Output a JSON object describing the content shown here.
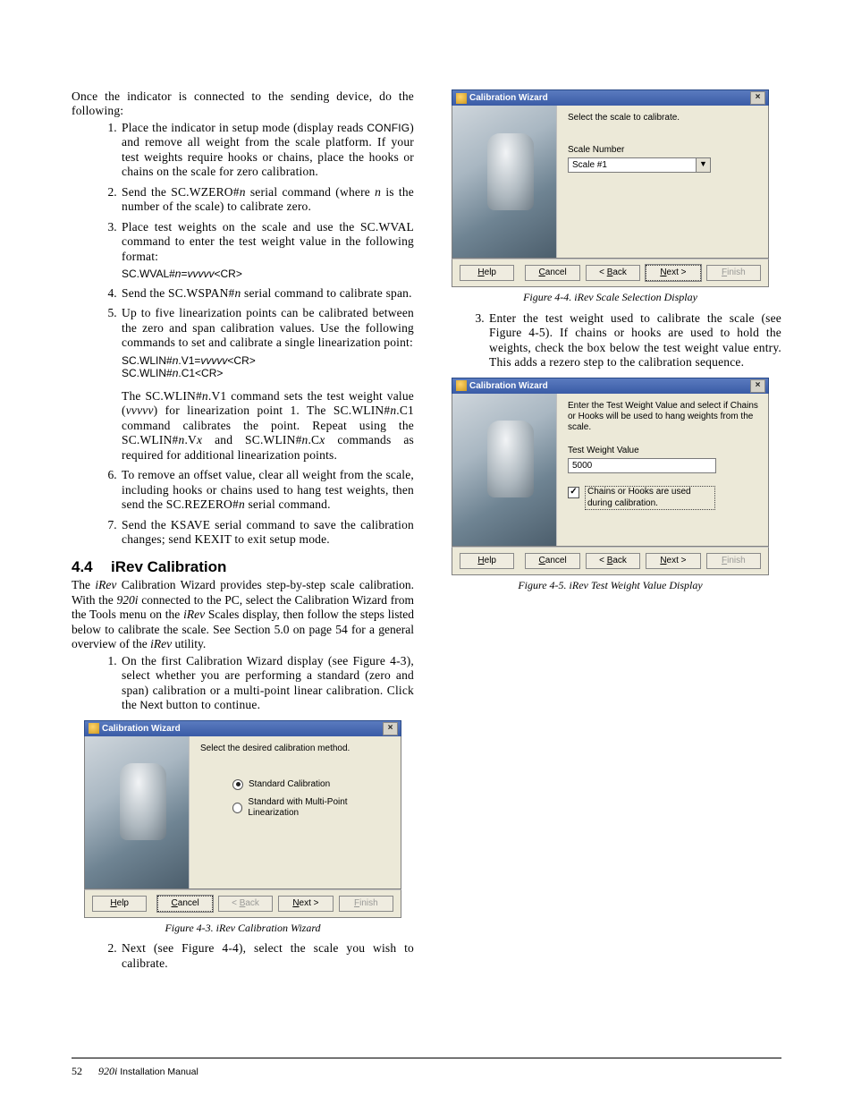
{
  "intro": "Once the indicator is connected to the sending device, do the following:",
  "steps": [
    {
      "text": "Place the indicator in setup mode (display reads CONFIG) and remove all weight from the scale platform. If your test weights require hooks or chains, place the hooks or chains on the scale for zero calibration."
    },
    {
      "text": "Send the SC.WZERO#n serial command (where n is the number of the scale) to calibrate zero."
    },
    {
      "text": "Place test weights on the scale and use the SC.WVAL command to enter the test weight value in the following format:",
      "cmd1": "SC.WVAL#n=vvvvv<CR>"
    },
    {
      "text": "Send the SC.WSPAN#n serial command to calibrate span."
    },
    {
      "text": "Up to five linearization points can be calibrated between the zero and span calibration values. Use the following commands to set and calibrate a single linearization point:",
      "cmd1": "SC.WLIN#n.V1=vvvvv<CR>",
      "cmd2": "SC.WLIN#n.C1<CR>",
      "after": "The SC.WLIN#n.V1 command sets the test weight value (vvvvv) for linearization point 1. The SC.WLIN#n.C1 command calibrates the point. Repeat using the SC.WLIN#n.Vx and SC.WLIN#n.Cx commands as required for additional linearization points."
    },
    {
      "text": "To remove an offset value, clear all weight from the scale, including hooks or chains used to hang test weights, then send the SC.REZERO#n serial command."
    },
    {
      "text": "Send the KSAVE serial command to save the calibration changes; send KEXIT to exit setup mode."
    }
  ],
  "section": {
    "num": "4.4",
    "title": "iRev Calibration"
  },
  "sectionIntro": "The iRev Calibration Wizard provides step-by-step scale calibration. With the 920i connected to the PC, select the Calibration Wizard from the Tools menu on the iRev Scales display, then follow the steps listed below to calibrate the scale. See Section 5.0 on page 54 for a general overview of the iRev utility.",
  "wizSteps": {
    "s1": "On the first Calibration Wizard display (see Figure 4-3), select whether you are performing a standard (zero and span) calibration or a multi-point linear calibration. Click the Next button to continue.",
    "s2": "Next (see Figure 4-4), select the scale you wish to calibrate.",
    "s3": "Enter the test weight used to calibrate the scale (see Figure 4-5). If chains or hooks are used to hold the weights, check the box below the test weight value entry. This adds a rezero step to the calibration sequence."
  },
  "dlg": {
    "title": "Calibration Wizard",
    "help": "Help",
    "cancel": "Cancel",
    "back": "< Back",
    "next": "Next >",
    "finish": "Finish"
  },
  "fig3": {
    "prompt": "Select the desired calibration method.",
    "opt1": "Standard Calibration",
    "opt2": "Standard with Multi-Point Linearization",
    "caption": "Figure 4-3. iRev Calibration Wizard"
  },
  "fig4": {
    "prompt": "Select the scale to calibrate.",
    "label": "Scale Number",
    "value": "Scale #1",
    "caption": "Figure 4-4. iRev Scale Selection Display"
  },
  "fig5": {
    "prompt": "Enter the Test Weight Value and select if Chains or Hooks will be used to hang weights from the scale.",
    "label": "Test Weight Value",
    "value": "5000",
    "chk": "Chains or Hooks are used during calibration.",
    "caption": "Figure 4-5. iRev Test Weight Value Display"
  },
  "footer": {
    "page": "52",
    "doc": "920i",
    "suffix": " Installation Manual"
  }
}
